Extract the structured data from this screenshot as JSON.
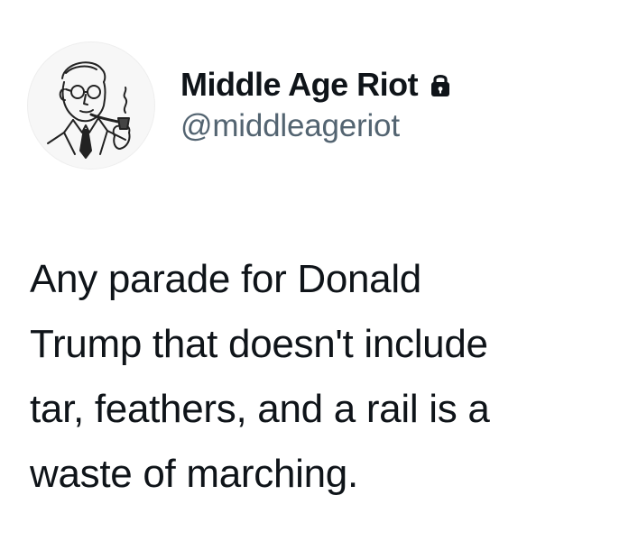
{
  "author": {
    "display_name": "Middle Age Riot",
    "handle": "@middleageriot",
    "avatar_icon": "retro-man-with-pipe-illustration",
    "protected_icon": "lock-icon"
  },
  "tweet": {
    "text": "Any parade for Donald\nTrump that doesn't include\ntar, feathers, and a rail is a\nwaste of marching."
  },
  "colors": {
    "text_primary": "#0f1419",
    "text_secondary": "#536471",
    "background": "#ffffff"
  }
}
